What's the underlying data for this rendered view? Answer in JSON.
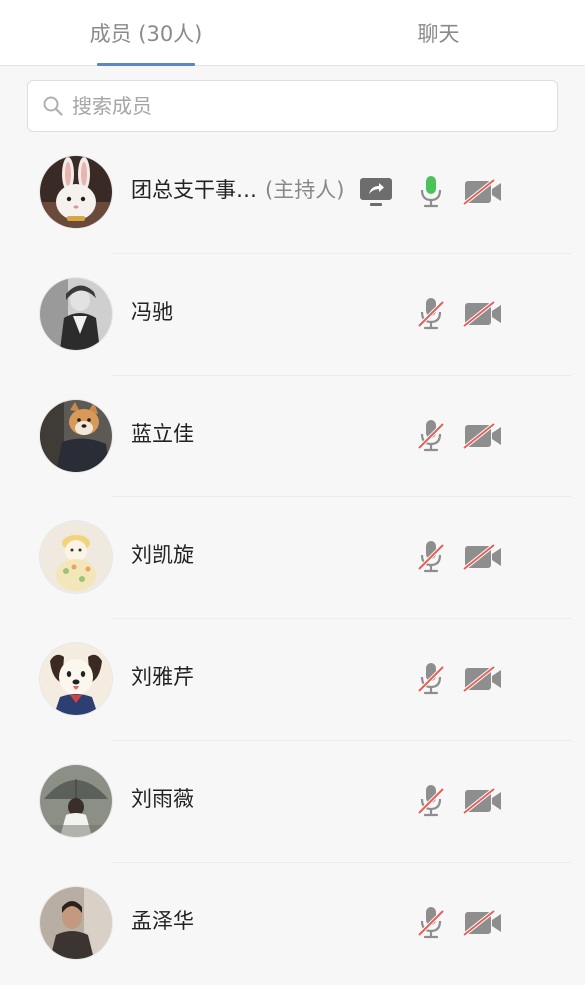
{
  "tabs": {
    "members_label": "成员 (30人)",
    "chat_label": "聊天"
  },
  "search": {
    "placeholder": "搜索成员"
  },
  "colors": {
    "accent": "#5b86c5",
    "mic_active": "#4cc35a",
    "muted_slash": "#e5605a",
    "icon_gray": "#8e8e8e"
  },
  "members": [
    {
      "name": "团总支干事…",
      "role_tag": "(主持人)",
      "sharing_screen": true,
      "mic": "on",
      "camera": "off",
      "avatar": "rabbit-avatar"
    },
    {
      "name": "冯驰",
      "mic": "muted",
      "camera": "off",
      "avatar": "bw-photo-avatar"
    },
    {
      "name": "蓝立佳",
      "mic": "muted",
      "camera": "off",
      "avatar": "shiba-avatar"
    },
    {
      "name": "刘凯旋",
      "mic": "muted",
      "camera": "off",
      "avatar": "plush-toy-avatar"
    },
    {
      "name": "刘雅芹",
      "mic": "muted",
      "camera": "off",
      "avatar": "cartoon-dog-avatar"
    },
    {
      "name": "刘雨薇",
      "mic": "muted",
      "camera": "off",
      "avatar": "umbrella-avatar"
    },
    {
      "name": "孟泽华",
      "mic": "muted",
      "camera": "off",
      "avatar": "portrait-avatar"
    }
  ]
}
